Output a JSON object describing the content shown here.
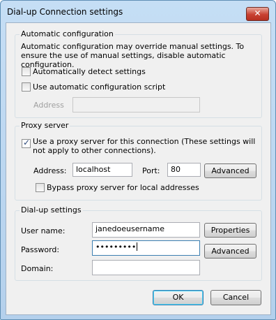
{
  "window": {
    "title": "Dial-up Connection settings",
    "close_glyph": "✕"
  },
  "auto_config": {
    "legend": "Automatic configuration",
    "description": "Automatic configuration may override manual settings.  To ensure the use of manual settings, disable automatic configuration.",
    "detect_label": "Automatically detect settings",
    "detect_checked": false,
    "script_label": "Use automatic configuration script",
    "script_checked": false,
    "address_label": "Address",
    "address_value": ""
  },
  "proxy": {
    "legend": "Proxy server",
    "use_proxy_label": "Use a proxy server for this connection (These settings will not apply to other connections).",
    "use_proxy_checked": true,
    "address_label": "Address:",
    "address_value": "localhost",
    "port_label": "Port:",
    "port_value": "80",
    "advanced_label": "Advanced",
    "bypass_label": "Bypass proxy server for local addresses",
    "bypass_checked": false
  },
  "dialup": {
    "legend": "Dial-up settings",
    "username_label": "User name:",
    "username_value": "janedoeusername",
    "properties_label": "Properties",
    "password_label": "Password:",
    "password_value": "•••••••••",
    "advanced_label": "Advanced",
    "domain_label": "Domain:",
    "domain_value": ""
  },
  "footer": {
    "ok_label": "OK",
    "cancel_label": "Cancel"
  }
}
